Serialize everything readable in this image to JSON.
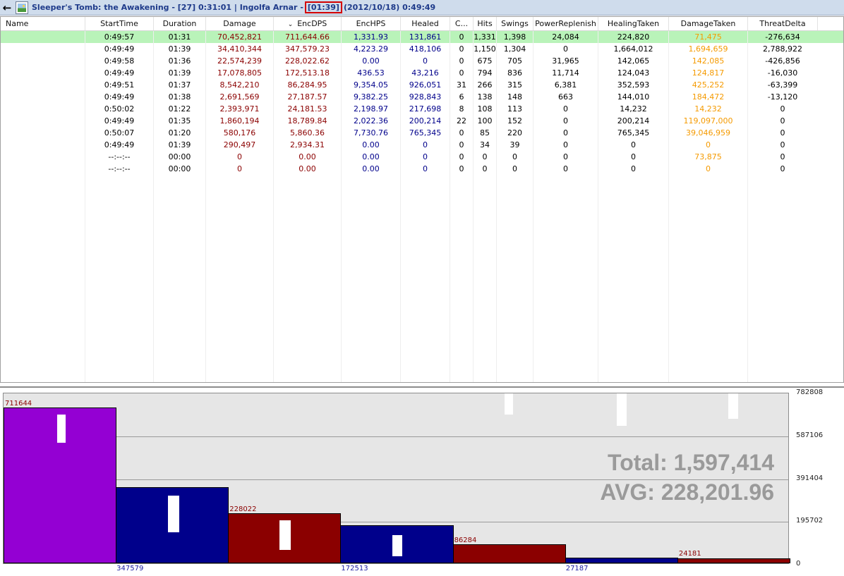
{
  "titlebar": {
    "zone": "Sleeper's Tomb: the Awakening - [27] 0:31:01 | Ingolfa Arnar -",
    "duration": "[01:39]",
    "date": "(2012/10/18) 0:49:49"
  },
  "grid": {
    "headers": [
      "Name",
      "StartTime",
      "Duration",
      "Damage",
      "EncDPS",
      "EncHPS",
      "Healed",
      "C...",
      "Hits",
      "Swings",
      "PowerReplenish",
      "HealingTaken",
      "DamageTaken",
      "ThreatDelta"
    ],
    "sort_indicator": "⌄",
    "rows": [
      [
        "",
        "0:49:57",
        "01:31",
        "70,452,821",
        "711,644.66",
        "1,331.93",
        "131,861",
        "0",
        "1,331",
        "1,398",
        "24,084",
        "224,820",
        "71,475",
        "-276,634"
      ],
      [
        "",
        "0:49:49",
        "01:39",
        "34,410,344",
        "347,579.23",
        "4,223.29",
        "418,106",
        "0",
        "1,150",
        "1,304",
        "0",
        "1,664,012",
        "1,694,659",
        "2,788,922"
      ],
      [
        "",
        "0:49:58",
        "01:36",
        "22,574,239",
        "228,022.62",
        "0.00",
        "0",
        "0",
        "675",
        "705",
        "31,965",
        "142,065",
        "142,085",
        "-426,856"
      ],
      [
        "",
        "0:49:49",
        "01:39",
        "17,078,805",
        "172,513.18",
        "436.53",
        "43,216",
        "0",
        "794",
        "836",
        "11,714",
        "124,043",
        "124,817",
        "-16,030"
      ],
      [
        "",
        "0:49:51",
        "01:37",
        "8,542,210",
        "86,284.95",
        "9,354.05",
        "926,051",
        "31",
        "266",
        "315",
        "6,381",
        "352,593",
        "425,252",
        "-63,399"
      ],
      [
        "",
        "0:49:49",
        "01:38",
        "2,691,569",
        "27,187.57",
        "9,382.25",
        "928,843",
        "6",
        "138",
        "148",
        "663",
        "144,010",
        "184,472",
        "-13,120"
      ],
      [
        "",
        "0:50:02",
        "01:22",
        "2,393,971",
        "24,181.53",
        "2,198.97",
        "217,698",
        "8",
        "108",
        "113",
        "0",
        "14,232",
        "14,232",
        "0"
      ],
      [
        "",
        "0:49:49",
        "01:35",
        "1,860,194",
        "18,789.84",
        "2,022.36",
        "200,214",
        "22",
        "100",
        "152",
        "0",
        "200,214",
        "119,097,000",
        "0"
      ],
      [
        "",
        "0:50:07",
        "01:20",
        "580,176",
        "5,860.36",
        "7,730.76",
        "765,345",
        "0",
        "85",
        "220",
        "0",
        "765,345",
        "39,046,959",
        "0"
      ],
      [
        "",
        "0:49:49",
        "01:39",
        "290,497",
        "2,934.31",
        "0.00",
        "0",
        "0",
        "34",
        "39",
        "0",
        "0",
        "0",
        "0"
      ],
      [
        "",
        "--:--:--",
        "00:00",
        "0",
        "0.00",
        "0.00",
        "0",
        "0",
        "0",
        "0",
        "0",
        "0",
        "73,875",
        "0"
      ],
      [
        "",
        "--:--:--",
        "00:00",
        "0",
        "0.00",
        "0.00",
        "0",
        "0",
        "0",
        "0",
        "0",
        "0",
        "0",
        "0"
      ]
    ]
  },
  "graph": {
    "total": "Total: 1,597,414",
    "avg": "AVG: 228,201.96",
    "y_ticks": [
      "782808",
      "587106",
      "391404",
      "195702",
      "0"
    ],
    "bar_labels_top": [
      "711644",
      "228022",
      "86284",
      "24181"
    ],
    "bar_labels_bottom": [
      "347579",
      "172513",
      "27187"
    ]
  },
  "chart_data": {
    "type": "bar",
    "categories": [
      "1",
      "2",
      "3",
      "4",
      "5",
      "6",
      "7"
    ],
    "values": [
      711644,
      347579,
      228022,
      172513,
      86284,
      27187,
      24181
    ],
    "colors": [
      "#9400d3",
      "#00008b",
      "#8b0000",
      "#00008b",
      "#8b0000",
      "#00008b",
      "#8b0000"
    ],
    "ylim": [
      0,
      782808
    ],
    "yticks": [
      0,
      195702,
      391404,
      587106,
      782808
    ]
  }
}
